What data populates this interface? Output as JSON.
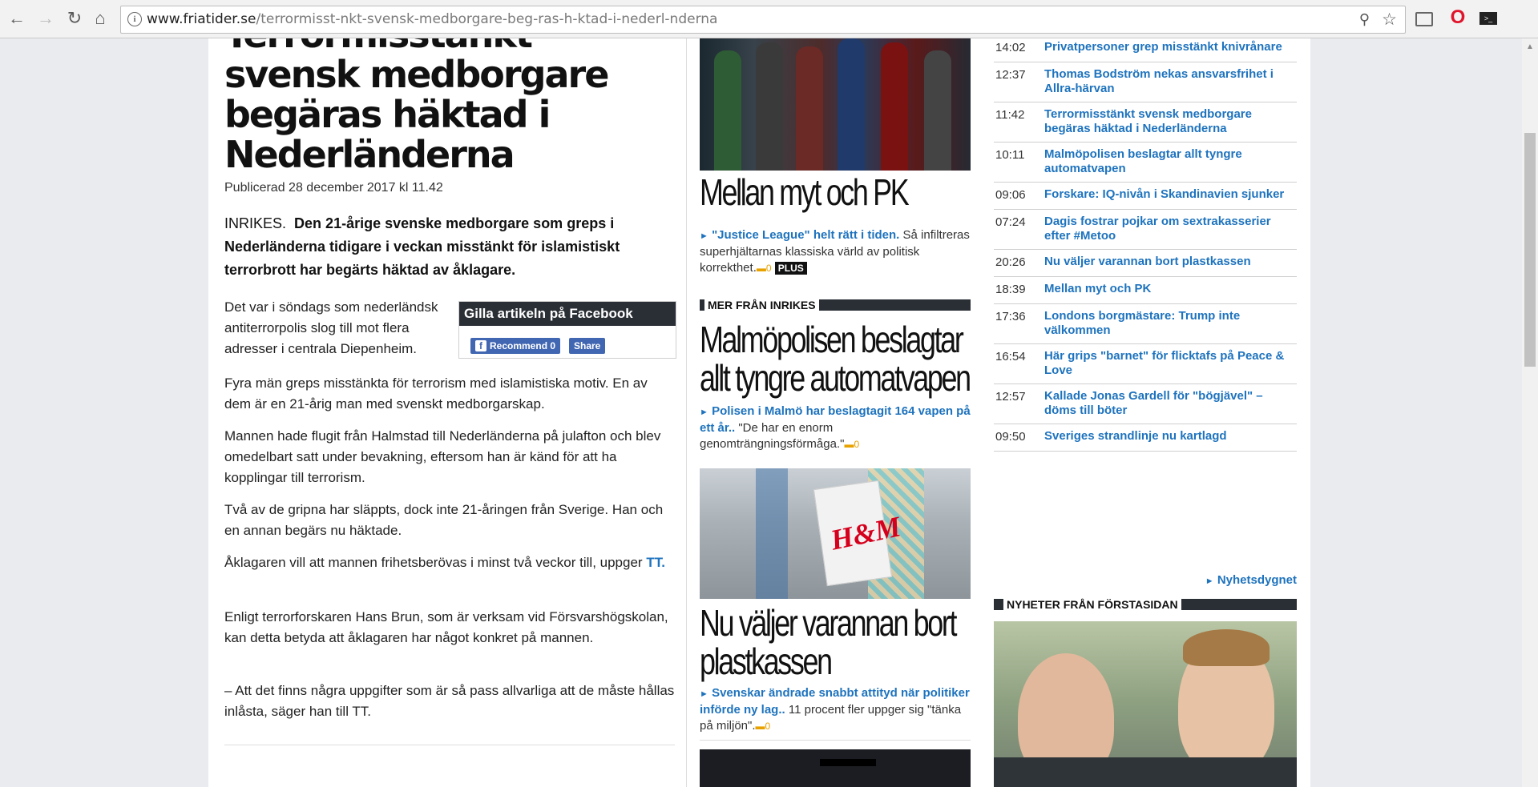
{
  "browser": {
    "url_host": "www.friatider.se",
    "url_path": "/terrormisst-nkt-svensk-medborgare-beg-ras-h-ktad-i-nederl-nderna"
  },
  "article": {
    "headline": "Terrormisstänkt svensk medborgare begäras häktad i Nederländerna",
    "published": "Publicerad 28 december 2017 kl 11.42",
    "category": "INRIKES.",
    "lead": "Den 21-årige svenske medborgare som greps i Nederländerna tidigare i veckan misstänkt för islamistiskt terrorbrott har begärts häktad av åklagare.",
    "paragraphs": [
      "Det var i söndags som nederländsk antiterrorpolis slog till mot flera adresser i centrala Diepenheim.",
      "Fyra män greps misstänkta för terrorism med islamistiska motiv. En av dem är en 21-årig man med svenskt medborgarskap.",
      "Mannen hade flugit från Halmstad till Nederländerna på julafton och blev omedelbart satt under bevakning, eftersom han är känd för att ha kopplingar till terrorism.",
      "Två av de gripna har släppts, dock inte 21-åringen från Sverige. Han och en annan begärs nu häktade.",
      "Åklagaren vill att mannen frihetsberövas i minst två veckor till, uppger",
      "Enligt terrorforskaren Hans Brun, som är verksam vid Försvarshögskolan, kan detta betyda att åklagaren har något konkret på mannen.",
      "– Att det finns några uppgifter som är så pass allvarliga att de måste hållas inlåsta, säger han till TT."
    ],
    "source_link": "TT.",
    "facebook": {
      "title": "Gilla artikeln på Facebook",
      "recommend": "Recommend 0",
      "share": "Share"
    }
  },
  "middle": {
    "story1": {
      "title": "Mellan myt och PK",
      "link": "\"Justice League\" helt rätt i tiden.",
      "text": "Så infiltreras superhjältarnas klassiska värld av politisk korrekthet.",
      "comments": "0",
      "badge": "PLUS"
    },
    "section": "MER FRÅN INRIKES",
    "story2": {
      "title": "Malmöpolisen beslagtar allt tyngre automatvapen",
      "link": "Polisen i Malmö har beslagtagit 164 vapen på ett år..",
      "text": "\"De har en enorm genomträngningsförmåga.\"",
      "comments": "0"
    },
    "story3": {
      "title": "Nu väljer varannan bort plastkassen",
      "link": "Svenskar ändrade snabbt attityd när politiker införde ny lag..",
      "text": "11 procent fler uppger sig \"tänka på miljön\".",
      "comments": "0",
      "image_text": "H&M"
    }
  },
  "right": {
    "news": [
      {
        "time": "14:02",
        "title": "Privatpersoner grep misstänkt knivrånare"
      },
      {
        "time": "12:37",
        "title": "Thomas Bodström nekas ansvarsfrihet i Allra-härvan"
      },
      {
        "time": "11:42",
        "title": "Terrormisstänkt svensk medborgare begäras häktad i Nederländerna"
      },
      {
        "time": "10:11",
        "title": "Malmöpolisen beslagtar allt tyngre automatvapen"
      },
      {
        "time": "09:06",
        "title": "Forskare: IQ-nivån i Skandinavien sjunker"
      },
      {
        "time": "07:24",
        "title": "Dagis fostrar pojkar om sextrakasserier efter #Metoo"
      },
      {
        "time": "20:26",
        "title": "Nu väljer varannan bort plastkassen"
      },
      {
        "time": "18:39",
        "title": "Mellan myt och PK"
      },
      {
        "time": "17:36",
        "title": "Londons borgmästare: Trump inte välkommen"
      },
      {
        "time": "16:54",
        "title": "Här grips \"barnet\" för flicktafs på Peace & Love"
      },
      {
        "time": "12:57",
        "title": "Kallade Jonas Gardell för \"bögjävel\" – döms till böter"
      },
      {
        "time": "09:50",
        "title": "Sveriges strandlinje nu kartlagd"
      }
    ],
    "more_link": "Nyhetsdygnet",
    "section": "NYHETER FRÅN FÖRSTASIDAN"
  }
}
